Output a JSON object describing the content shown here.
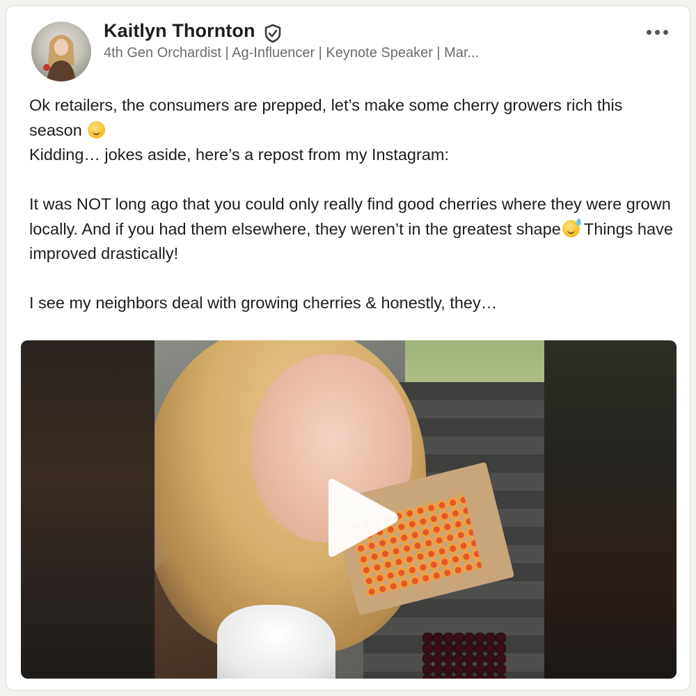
{
  "post": {
    "author": {
      "name": "Kaitlyn Thornton",
      "headline": "4th Gen Orchardist | Ag-Influencer | Keynote Speaker | Mar..."
    },
    "icons": {
      "verified": "shield-check-icon",
      "more": "more-options-icon",
      "play": "play-icon"
    },
    "body": {
      "line1": "Ok retailers, the consumers are prepped, let’s make some cherry growers rich this season",
      "line2": "Kidding… jokes aside, here’s a repost from my Instagram:",
      "line3a": "It was NOT long ago that you could only really find good cherries where they were grown locally. And if you had them elsewhere, they weren’t in the greatest shape",
      "line3b": " Things have improved drastically!",
      "line4": "I see my neighbors deal with growing cherries & honestly, they…"
    },
    "emojis": [
      "smirking-face-emoji",
      "grinning-sweat-emoji"
    ]
  }
}
